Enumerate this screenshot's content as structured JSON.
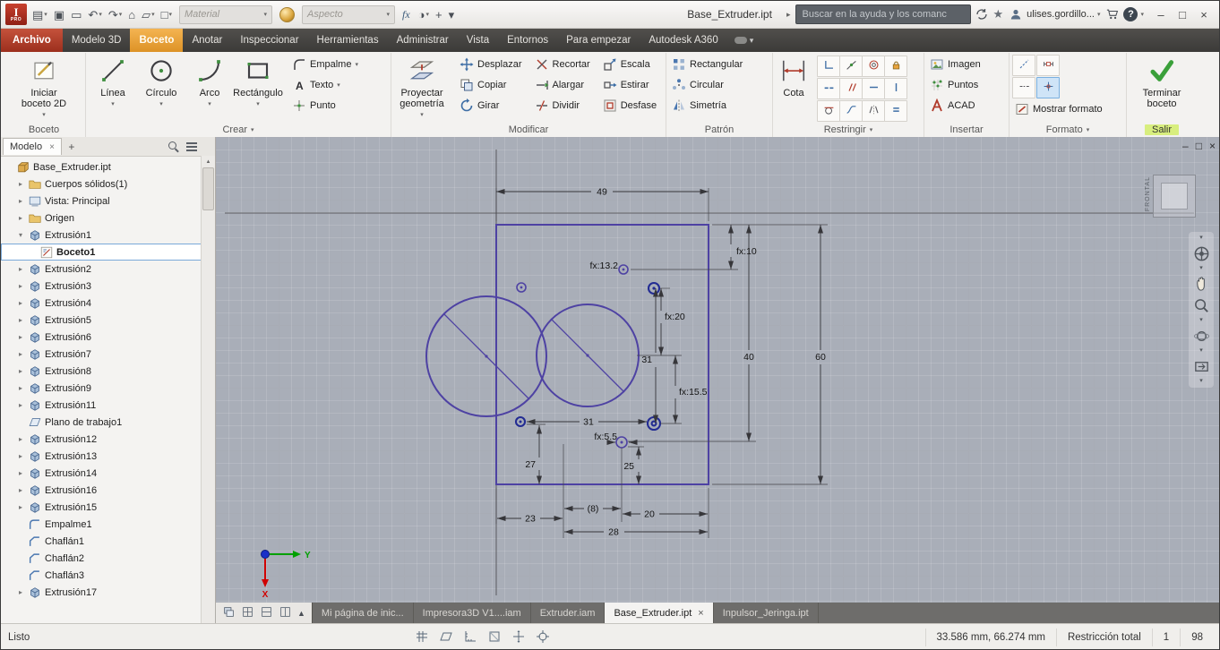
{
  "glyphs": {
    "dropdown": "▾",
    "expander_closed": "▸",
    "expander_open": "▾",
    "minimize": "–",
    "maximize": "□",
    "close": "×",
    "tab_close": "×",
    "plus": "+",
    "star": "★",
    "right_arrow": "▸",
    "up_arrow": "▲"
  },
  "titlebar": {
    "logo_letter": "I",
    "logo_sub": "PRO",
    "doc_title": "Base_Extruder.ipt",
    "material_value": "Material",
    "aspecto_value": "Aspecto",
    "fx_label": "fx",
    "search_placeholder": "Buscar en la ayuda y los comanc",
    "user_name": "ulises.gordillo...",
    "help_label": "?",
    "tools": [
      {
        "name": "application-menu",
        "glyph": "▤",
        "dd": true
      },
      {
        "name": "save",
        "glyph": "▣",
        "dd": false
      },
      {
        "name": "open",
        "glyph": "▭",
        "dd": false
      },
      {
        "name": "undo",
        "glyph": "↶",
        "dd": true
      },
      {
        "name": "redo",
        "glyph": "↷",
        "dd": true
      },
      {
        "name": "home",
        "glyph": "⌂",
        "dd": false
      },
      {
        "name": "return-to-sketch",
        "glyph": "▱",
        "dd": true
      },
      {
        "name": "select",
        "glyph": "□",
        "dd": true
      }
    ],
    "tools_right": [
      {
        "name": "adjust-appearance",
        "glyph": "◑",
        "dd": true
      },
      {
        "name": "measure",
        "glyph": "+",
        "dd": false
      },
      {
        "name": "more-tools",
        "glyph": "▾",
        "dd": false
      }
    ]
  },
  "ribbon": {
    "tabs": [
      {
        "label": "Archivo",
        "file": true
      },
      {
        "label": "Modelo 3D"
      },
      {
        "label": "Boceto",
        "active": true
      },
      {
        "label": "Anotar"
      },
      {
        "label": "Inspeccionar"
      },
      {
        "label": "Herramientas"
      },
      {
        "label": "Administrar"
      },
      {
        "label": "Vista"
      },
      {
        "label": "Entornos"
      },
      {
        "label": "Para empezar"
      },
      {
        "label": "Autodesk A360"
      }
    ],
    "panels": {
      "boceto": {
        "label": "Boceto",
        "start_sketch": "Iniciar boceto 2D"
      },
      "crear": {
        "label": "Crear",
        "big_tools": [
          {
            "name": "linea",
            "label": "Línea",
            "icon": "linea",
            "dd": true
          },
          {
            "name": "circulo",
            "label": "Círculo",
            "icon": "circulo",
            "dd": true
          },
          {
            "name": "arco",
            "label": "Arco",
            "icon": "arco",
            "dd": true
          },
          {
            "name": "rectangulo",
            "label": "Rectángulo",
            "icon": "rectangulo",
            "dd": true
          }
        ],
        "small_tools": [
          {
            "name": "empalme",
            "label": "Empalme",
            "icon": "empalme",
            "dd": true
          },
          {
            "name": "texto",
            "label": "Texto",
            "icon": "texto",
            "dd": true
          },
          {
            "name": "punto",
            "label": "Punto",
            "icon": "punto",
            "dd": false
          }
        ]
      },
      "modificar": {
        "label": "Modificar",
        "big_label": "Proyectar geometría",
        "grid_tools": [
          {
            "name": "desplazar",
            "label": "Desplazar",
            "icon": "desplazar"
          },
          {
            "name": "recortar",
            "label": "Recortar",
            "icon": "recortar"
          },
          {
            "name": "escala",
            "label": "Escala",
            "icon": "escala"
          },
          {
            "name": "copiar",
            "label": "Copiar",
            "icon": "copiar"
          },
          {
            "name": "alargar",
            "label": "Alargar",
            "icon": "alargar"
          },
          {
            "name": "estirar",
            "label": "Estirar",
            "icon": "estirar"
          },
          {
            "name": "girar",
            "label": "Girar",
            "icon": "girar"
          },
          {
            "name": "dividir",
            "label": "Dividir",
            "icon": "dividir"
          },
          {
            "name": "desfase",
            "label": "Desfase",
            "icon": "desfase"
          }
        ]
      },
      "patron": {
        "label": "Patrón",
        "tools": [
          {
            "name": "patron-rectangular",
            "label": "Rectangular",
            "icon": "patron_rect"
          },
          {
            "name": "patron-circular",
            "label": "Circular",
            "icon": "patron_circ"
          },
          {
            "name": "simetria",
            "label": "Simetría",
            "icon": "simetria"
          }
        ]
      },
      "restringir": {
        "label": "Restringir",
        "big_label": "Cota",
        "constraints": [
          {
            "name": "restriccion-perpendicular",
            "icon": "perpendicular"
          },
          {
            "name": "restriccion-coincidente",
            "icon": "coincidente"
          },
          {
            "name": "restriccion-concentrica",
            "icon": "concentrica"
          },
          {
            "name": "restriccion-fija",
            "icon": "fija"
          },
          {
            "name": "restriccion-colineal",
            "icon": "colineal"
          },
          {
            "name": "restriccion-paralela",
            "icon": "paralela"
          },
          {
            "name": "restriccion-horizontal",
            "icon": "horizontal"
          },
          {
            "name": "restriccion-vertical",
            "icon": "vertical"
          },
          {
            "name": "restriccion-tangente",
            "icon": "tangente"
          },
          {
            "name": "restriccion-suavizado",
            "icon": "suavizado"
          },
          {
            "name": "restriccion-simetrica",
            "icon": "simetrica"
          },
          {
            "name": "restriccion-igual",
            "icon": "igual"
          }
        ]
      },
      "insertar": {
        "label": "Insertar",
        "tools": [
          {
            "name": "imagen",
            "label": "Imagen",
            "icon": "imagen"
          },
          {
            "name": "puntos",
            "label": "Puntos",
            "icon": "puntos"
          },
          {
            "name": "acad",
            "label": "ACAD",
            "icon": "acad"
          }
        ]
      },
      "formato": {
        "label": "Formato",
        "show_format_label": "Mostrar formato",
        "tools": [
          {
            "name": "linea-construccion",
            "icon": "construccion",
            "hl": false
          },
          {
            "name": "cota-por-referencia",
            "icon": "refdim",
            "hl": false
          },
          {
            "name": "eje",
            "icon": "centerline",
            "hl": false
          },
          {
            "name": "punto-centro",
            "icon": "centerpoint",
            "hl": true
          }
        ]
      },
      "salir": {
        "label": "Salir",
        "finish_label": "Terminar boceto"
      }
    }
  },
  "browser": {
    "panel_tab": "Modelo",
    "tree": [
      {
        "label": "Base_Extruder.ipt",
        "level": 0,
        "icon": "part"
      },
      {
        "label": "Cuerpos sólidos(1)",
        "level": 1,
        "icon": "folder",
        "chev": "closed"
      },
      {
        "label": "Vista: Principal",
        "level": 1,
        "icon": "view",
        "chev": "closed"
      },
      {
        "label": "Origen",
        "level": 1,
        "icon": "folder",
        "chev": "closed"
      },
      {
        "label": "Extrusión1",
        "level": 1,
        "icon": "extrude",
        "chev": "open"
      },
      {
        "label": "Boceto1",
        "level": 2,
        "icon": "sketch",
        "selected": true
      },
      {
        "label": "Extrusión2",
        "level": 1,
        "icon": "extrude",
        "chev": "closed"
      },
      {
        "label": "Extrusión3",
        "level": 1,
        "icon": "extrude",
        "chev": "closed"
      },
      {
        "label": "Extrusión4",
        "level": 1,
        "icon": "extrude",
        "chev": "closed"
      },
      {
        "label": "Extrusión5",
        "level": 1,
        "icon": "extrude",
        "chev": "closed"
      },
      {
        "label": "Extrusión6",
        "level": 1,
        "icon": "extrude",
        "chev": "closed"
      },
      {
        "label": "Extrusión7",
        "level": 1,
        "icon": "extrude",
        "chev": "closed"
      },
      {
        "label": "Extrusión8",
        "level": 1,
        "icon": "extrude",
        "chev": "closed"
      },
      {
        "label": "Extrusión9",
        "level": 1,
        "icon": "extrude",
        "chev": "closed"
      },
      {
        "label": "Extrusión11",
        "level": 1,
        "icon": "extrude",
        "chev": "closed"
      },
      {
        "label": "Plano de trabajo1",
        "level": 1,
        "icon": "workplane"
      },
      {
        "label": "Extrusión12",
        "level": 1,
        "icon": "extrude",
        "chev": "closed"
      },
      {
        "label": "Extrusión13",
        "level": 1,
        "icon": "extrude",
        "chev": "closed"
      },
      {
        "label": "Extrusión14",
        "level": 1,
        "icon": "extrude",
        "chev": "closed"
      },
      {
        "label": "Extrusión16",
        "level": 1,
        "icon": "extrude",
        "chev": "closed"
      },
      {
        "label": "Extrusión15",
        "level": 1,
        "icon": "extrude",
        "chev": "closed"
      },
      {
        "label": "Empalme1",
        "level": 1,
        "icon": "fillet"
      },
      {
        "label": "Chaflán1",
        "level": 1,
        "icon": "chamfer"
      },
      {
        "label": "Chaflán2",
        "level": 1,
        "icon": "chamfer"
      },
      {
        "label": "Chaflán3",
        "level": 1,
        "icon": "chamfer"
      },
      {
        "label": "Extrusión17",
        "level": 1,
        "icon": "extrude",
        "chev": "closed"
      }
    ]
  },
  "canvas": {
    "viewcube_face": "FRONTAL",
    "axis_x": "X",
    "axis_y": "Y",
    "dims": {
      "d49": "49",
      "d60": "60",
      "d40": "40",
      "fx10": "fx:10",
      "fx132": "fx:13.2",
      "fx20": "fx:20",
      "v31": "31",
      "fx155": "fx:15.5",
      "h31": "31",
      "fx55": "fx:5.5",
      "d27": "27",
      "d25": "25",
      "d8": "(8)",
      "d23": "23",
      "d20": "20",
      "d28": "28"
    }
  },
  "doctabs": [
    {
      "label": "Mi página de inic...",
      "active": false
    },
    {
      "label": "Impresora3D V1....iam",
      "active": false
    },
    {
      "label": "Extruder.iam",
      "active": false
    },
    {
      "label": "Base_Extruder.ipt",
      "active": true,
      "closable": true
    },
    {
      "label": "Inpulsor_Jeringa.ipt",
      "active": false
    }
  ],
  "statusbar": {
    "message": "Listo",
    "coords": "33.586 mm, 66.274 mm",
    "constraint_state": "Restricción total",
    "dof": "1",
    "sketch_count": "98"
  }
}
